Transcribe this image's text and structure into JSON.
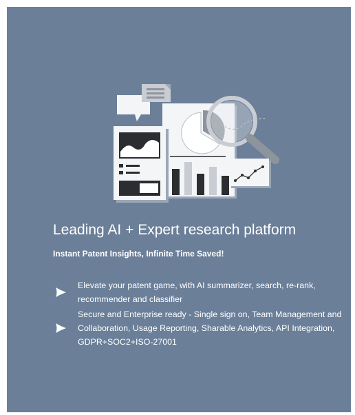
{
  "hero": {
    "title": "Leading AI + Expert research platform",
    "subtitle": "Instant Patent Insights, Infinite Time Saved!",
    "illustration_icon": "report-analytics-illustration"
  },
  "features": [
    {
      "icon": "bullet-arrow-icon",
      "text": "Elevate your patent game, with AI summarizer, search, re-rank, recommender and classifier"
    },
    {
      "icon": "bullet-arrow-icon",
      "text": "Secure and Enterprise ready - Single sign on, Team Management and Collaboration, Usage Reporting, Sharable Analytics, API Integration, GDPR+SOC2+ISO-27001"
    }
  ],
  "colors": {
    "panel_background": "#6b7f99",
    "text": "#ffffff"
  }
}
